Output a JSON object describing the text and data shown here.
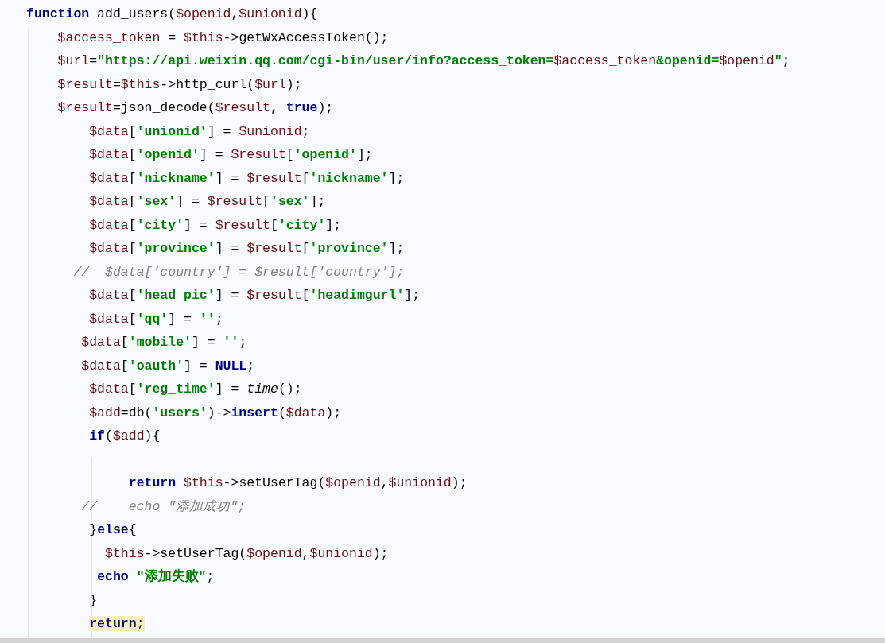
{
  "editor": {
    "lines": [
      {
        "kind": "code",
        "highlighted": false,
        "tokens": [
          {
            "kind": "kw",
            "text": "function"
          },
          {
            "kind": "plain",
            "text": " add_users("
          },
          {
            "kind": "var",
            "text": "$openid"
          },
          {
            "kind": "plain",
            "text": ","
          },
          {
            "kind": "var",
            "text": "$unionid"
          },
          {
            "kind": "plain",
            "text": "){"
          }
        ]
      },
      {
        "kind": "code",
        "highlighted": false,
        "tokens": [
          {
            "kind": "var",
            "text": "    $access_token"
          },
          {
            "kind": "plain",
            "text": " = "
          },
          {
            "kind": "var",
            "text": "$this"
          },
          {
            "kind": "plain",
            "text": "->getWxAccessToken();"
          }
        ]
      },
      {
        "kind": "code",
        "highlighted": false,
        "tokens": [
          {
            "kind": "var",
            "text": "    $url"
          },
          {
            "kind": "plain",
            "text": "="
          },
          {
            "kind": "str",
            "text": "\"https://api.weixin.qq.com/cgi-bin/user/info?access_token="
          },
          {
            "kind": "var",
            "text": "$access_token"
          },
          {
            "kind": "str",
            "text": "&openid="
          },
          {
            "kind": "var",
            "text": "$openid"
          },
          {
            "kind": "str",
            "text": "\""
          },
          {
            "kind": "plain",
            "text": ";"
          }
        ]
      },
      {
        "kind": "code",
        "highlighted": false,
        "tokens": [
          {
            "kind": "var",
            "text": "    $result"
          },
          {
            "kind": "plain",
            "text": "="
          },
          {
            "kind": "var",
            "text": "$this"
          },
          {
            "kind": "plain",
            "text": "->http_curl("
          },
          {
            "kind": "var",
            "text": "$url"
          },
          {
            "kind": "plain",
            "text": ");"
          }
        ]
      },
      {
        "kind": "code",
        "highlighted": false,
        "tokens": [
          {
            "kind": "var",
            "text": "    $result"
          },
          {
            "kind": "plain",
            "text": "=json_decode("
          },
          {
            "kind": "var",
            "text": "$result"
          },
          {
            "kind": "plain",
            "text": ", "
          },
          {
            "kind": "kw",
            "text": "true"
          },
          {
            "kind": "plain",
            "text": ");"
          }
        ]
      },
      {
        "kind": "code",
        "highlighted": false,
        "tokens": [
          {
            "kind": "var",
            "text": "        $data"
          },
          {
            "kind": "plain",
            "text": "["
          },
          {
            "kind": "str",
            "text": "'unionid'"
          },
          {
            "kind": "plain",
            "text": "] = "
          },
          {
            "kind": "var",
            "text": "$unionid"
          },
          {
            "kind": "plain",
            "text": ";"
          }
        ]
      },
      {
        "kind": "code",
        "highlighted": false,
        "tokens": [
          {
            "kind": "var",
            "text": "        $data"
          },
          {
            "kind": "plain",
            "text": "["
          },
          {
            "kind": "str",
            "text": "'openid'"
          },
          {
            "kind": "plain",
            "text": "] = "
          },
          {
            "kind": "var",
            "text": "$result"
          },
          {
            "kind": "plain",
            "text": "["
          },
          {
            "kind": "str",
            "text": "'openid'"
          },
          {
            "kind": "plain",
            "text": "];"
          }
        ]
      },
      {
        "kind": "code",
        "highlighted": false,
        "tokens": [
          {
            "kind": "var",
            "text": "        $data"
          },
          {
            "kind": "plain",
            "text": "["
          },
          {
            "kind": "str",
            "text": "'nickname'"
          },
          {
            "kind": "plain",
            "text": "] = "
          },
          {
            "kind": "var",
            "text": "$result"
          },
          {
            "kind": "plain",
            "text": "["
          },
          {
            "kind": "str",
            "text": "'nickname'"
          },
          {
            "kind": "plain",
            "text": "];"
          }
        ]
      },
      {
        "kind": "code",
        "highlighted": false,
        "tokens": [
          {
            "kind": "var",
            "text": "        $data"
          },
          {
            "kind": "plain",
            "text": "["
          },
          {
            "kind": "str",
            "text": "'sex'"
          },
          {
            "kind": "plain",
            "text": "] = "
          },
          {
            "kind": "var",
            "text": "$result"
          },
          {
            "kind": "plain",
            "text": "["
          },
          {
            "kind": "str",
            "text": "'sex'"
          },
          {
            "kind": "plain",
            "text": "];"
          }
        ]
      },
      {
        "kind": "code",
        "highlighted": false,
        "tokens": [
          {
            "kind": "var",
            "text": "        $data"
          },
          {
            "kind": "plain",
            "text": "["
          },
          {
            "kind": "str",
            "text": "'city'"
          },
          {
            "kind": "plain",
            "text": "] = "
          },
          {
            "kind": "var",
            "text": "$result"
          },
          {
            "kind": "plain",
            "text": "["
          },
          {
            "kind": "str",
            "text": "'city'"
          },
          {
            "kind": "plain",
            "text": "];"
          }
        ]
      },
      {
        "kind": "code",
        "highlighted": false,
        "tokens": [
          {
            "kind": "var",
            "text": "        $data"
          },
          {
            "kind": "plain",
            "text": "["
          },
          {
            "kind": "str",
            "text": "'province'"
          },
          {
            "kind": "plain",
            "text": "] = "
          },
          {
            "kind": "var",
            "text": "$result"
          },
          {
            "kind": "plain",
            "text": "["
          },
          {
            "kind": "str",
            "text": "'province'"
          },
          {
            "kind": "plain",
            "text": "];"
          }
        ]
      },
      {
        "kind": "code",
        "highlighted": false,
        "tokens": [
          {
            "kind": "com",
            "text": "      //  $data['country'] = $result['country'];"
          }
        ]
      },
      {
        "kind": "code",
        "highlighted": false,
        "tokens": [
          {
            "kind": "var",
            "text": "        $data"
          },
          {
            "kind": "plain",
            "text": "["
          },
          {
            "kind": "str",
            "text": "'head_pic'"
          },
          {
            "kind": "plain",
            "text": "] = "
          },
          {
            "kind": "var",
            "text": "$result"
          },
          {
            "kind": "plain",
            "text": "["
          },
          {
            "kind": "str",
            "text": "'headimgurl'"
          },
          {
            "kind": "plain",
            "text": "];"
          }
        ]
      },
      {
        "kind": "code",
        "highlighted": false,
        "tokens": [
          {
            "kind": "var",
            "text": "        $data"
          },
          {
            "kind": "plain",
            "text": "["
          },
          {
            "kind": "str",
            "text": "'qq'"
          },
          {
            "kind": "plain",
            "text": "] = "
          },
          {
            "kind": "str",
            "text": "''"
          },
          {
            "kind": "plain",
            "text": ";"
          }
        ]
      },
      {
        "kind": "code",
        "highlighted": false,
        "tokens": [
          {
            "kind": "var",
            "text": "       $data"
          },
          {
            "kind": "plain",
            "text": "["
          },
          {
            "kind": "str",
            "text": "'mobile'"
          },
          {
            "kind": "plain",
            "text": "] = "
          },
          {
            "kind": "str",
            "text": "''"
          },
          {
            "kind": "plain",
            "text": ";"
          }
        ]
      },
      {
        "kind": "code",
        "highlighted": false,
        "tokens": [
          {
            "kind": "var",
            "text": "       $data"
          },
          {
            "kind": "plain",
            "text": "["
          },
          {
            "kind": "str",
            "text": "'oauth'"
          },
          {
            "kind": "plain",
            "text": "] = "
          },
          {
            "kind": "kw",
            "text": "NULL"
          },
          {
            "kind": "plain",
            "text": ";"
          }
        ]
      },
      {
        "kind": "code",
        "highlighted": false,
        "tokens": [
          {
            "kind": "var",
            "text": "        $data"
          },
          {
            "kind": "plain",
            "text": "["
          },
          {
            "kind": "str",
            "text": "'reg_time'"
          },
          {
            "kind": "plain",
            "text": "] = "
          },
          {
            "kind": "ital",
            "text": "time"
          },
          {
            "kind": "plain",
            "text": "();"
          }
        ]
      },
      {
        "kind": "code",
        "highlighted": false,
        "tokens": [
          {
            "kind": "var",
            "text": "        $add"
          },
          {
            "kind": "plain",
            "text": "=db("
          },
          {
            "kind": "str",
            "text": "'users'"
          },
          {
            "kind": "plain",
            "text": ")->"
          },
          {
            "kind": "kw",
            "text": "insert"
          },
          {
            "kind": "plain",
            "text": "("
          },
          {
            "kind": "var",
            "text": "$data"
          },
          {
            "kind": "plain",
            "text": ");"
          }
        ]
      },
      {
        "kind": "code",
        "highlighted": false,
        "tokens": [
          {
            "kind": "kw",
            "text": "        if"
          },
          {
            "kind": "plain",
            "text": "("
          },
          {
            "kind": "var",
            "text": "$add"
          },
          {
            "kind": "plain",
            "text": "){"
          }
        ]
      },
      {
        "kind": "blank"
      },
      {
        "kind": "code",
        "highlighted": false,
        "tokens": [
          {
            "kind": "kw",
            "text": "             return"
          },
          {
            "kind": "var",
            "text": " $this"
          },
          {
            "kind": "plain",
            "text": "->setUserTag("
          },
          {
            "kind": "var",
            "text": "$openid"
          },
          {
            "kind": "plain",
            "text": ","
          },
          {
            "kind": "var",
            "text": "$unionid"
          },
          {
            "kind": "plain",
            "text": ");"
          }
        ]
      },
      {
        "kind": "code",
        "highlighted": false,
        "tokens": [
          {
            "kind": "com",
            "text": "       //    echo \"添加成功\";"
          }
        ]
      },
      {
        "kind": "code",
        "highlighted": false,
        "tokens": [
          {
            "kind": "plain",
            "text": "        }"
          },
          {
            "kind": "kw",
            "text": "else"
          },
          {
            "kind": "plain",
            "text": "{"
          }
        ]
      },
      {
        "kind": "code",
        "highlighted": false,
        "tokens": [
          {
            "kind": "var",
            "text": "          $this"
          },
          {
            "kind": "plain",
            "text": "->setUserTag("
          },
          {
            "kind": "var",
            "text": "$openid"
          },
          {
            "kind": "plain",
            "text": ","
          },
          {
            "kind": "var",
            "text": "$unionid"
          },
          {
            "kind": "plain",
            "text": ");"
          }
        ]
      },
      {
        "kind": "code",
        "highlighted": false,
        "tokens": [
          {
            "kind": "kw",
            "text": "         echo"
          },
          {
            "kind": "str",
            "text": " \"添加失败\""
          },
          {
            "kind": "plain",
            "text": ";"
          }
        ]
      },
      {
        "kind": "code",
        "highlighted": false,
        "tokens": [
          {
            "kind": "plain",
            "text": "        }"
          }
        ]
      },
      {
        "kind": "code",
        "highlighted": true,
        "tokens": [
          {
            "kind": "kw",
            "text": "        return"
          },
          {
            "kind": "plain",
            "text": ";"
          }
        ]
      }
    ]
  }
}
